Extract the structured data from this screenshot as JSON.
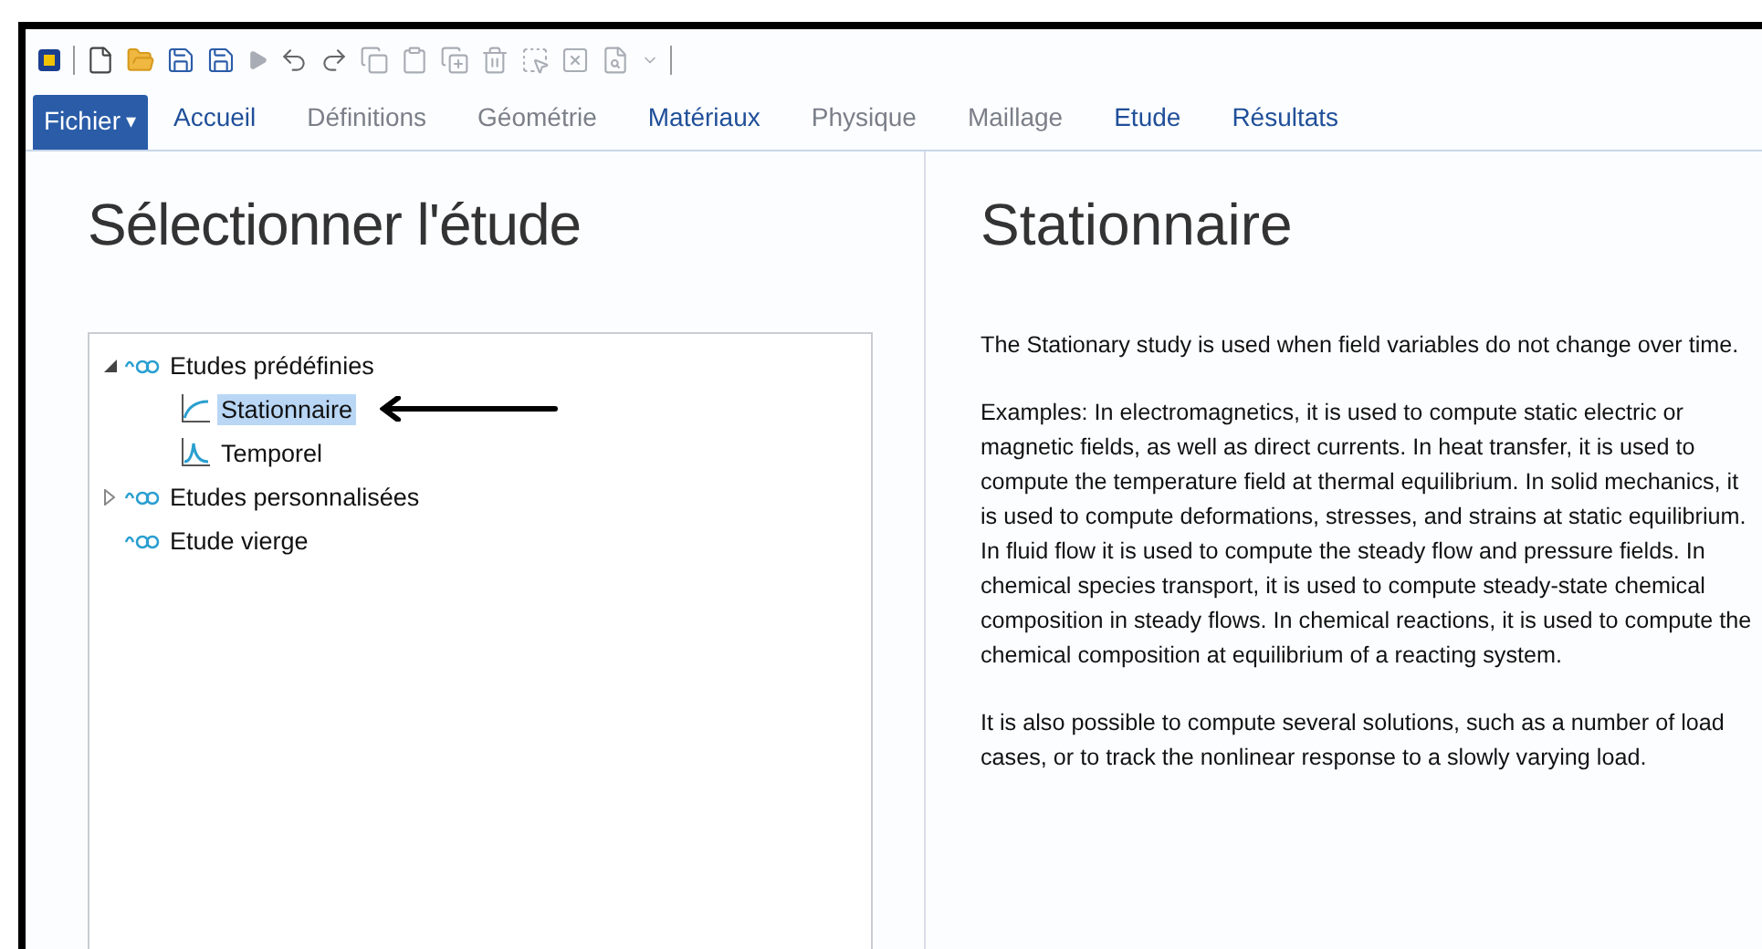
{
  "ribbon": {
    "file_menu": {
      "label": "Fichier",
      "caret": "▾"
    },
    "tabs": [
      {
        "label": "Accueil",
        "selected": false,
        "disabled": false
      },
      {
        "label": "Définitions",
        "selected": false,
        "disabled": true
      },
      {
        "label": "Géométrie",
        "selected": false,
        "disabled": true
      },
      {
        "label": "Matériaux",
        "selected": false,
        "disabled": false
      },
      {
        "label": "Physique",
        "selected": false,
        "disabled": true
      },
      {
        "label": "Maillage",
        "selected": false,
        "disabled": true
      },
      {
        "label": "Etude",
        "selected": false,
        "disabled": false
      },
      {
        "label": "Résultats",
        "selected": false,
        "disabled": false
      }
    ]
  },
  "left_panel": {
    "title": "Sélectionner l'étude",
    "tree": [
      {
        "label": "Etudes prédéfinies",
        "kind": "group",
        "expanded": true,
        "selected": false,
        "children": [
          {
            "label": "Stationnaire",
            "kind": "stationary",
            "selected": true
          },
          {
            "label": "Temporel",
            "kind": "transient",
            "selected": false
          }
        ]
      },
      {
        "label": "Etudes personnalisées",
        "kind": "group",
        "expanded": false,
        "selected": false
      },
      {
        "label": "Etude vierge",
        "kind": "group",
        "selected": false
      }
    ]
  },
  "right_panel": {
    "title": "Stationnaire",
    "paragraphs": [
      "The Stationary study is used when field variables do not change over time.",
      "Examples: In electromagnetics, it is used to compute static electric or magnetic fields, as well as direct currents. In heat transfer, it is used to compute the temperature field at thermal equilibrium. In solid mechanics, it is used to compute deformations, stresses, and strains at static equilibrium. In fluid flow it is used to compute the steady flow and pressure fields. In chemical species transport, it is used to compute steady-state chemical composition in steady flows. In chemical reactions, it is used to compute the chemical composition at equilibrium of a reacting system.",
      "It is also possible to compute several solutions, such as a number of load cases, or to track the nonlinear response to a slowly varying load."
    ]
  }
}
